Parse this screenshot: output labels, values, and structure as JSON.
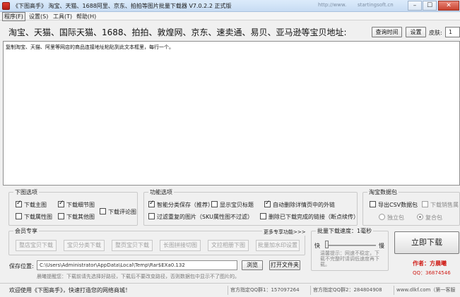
{
  "window": {
    "title": "《下图高手》 淘宝、天猫、1688阿里、京东、拍拍等图片批量下载器 V7.0.2.2 正式版",
    "ghost_tabs": [
      "http://www.",
      "startingsoft.cn"
    ],
    "minimize": "–",
    "maximize": "☐",
    "close": "✕"
  },
  "menu": [
    {
      "label": "程序(F)",
      "active": true
    },
    {
      "label": "设置(S)"
    },
    {
      "label": "工具(T)"
    },
    {
      "label": "帮助(H)"
    }
  ],
  "header": {
    "title": "淘宝、天猫、国际天猫、1688、拍拍、敦煌网、京东、速卖通、易贝、亚马逊等宝贝地址:",
    "query_time_button": "查询时间",
    "settings_button": "设置",
    "skin_label": "皮肤:",
    "skin_value": "1"
  },
  "url_textarea": {
    "text": "复制淘宝、天猫、阿里等网店的商品连接地址粘贴到此文本框里，每行一个。"
  },
  "download_options": {
    "title": "下图选项",
    "items": [
      {
        "label": "下载主图",
        "checked": true
      },
      {
        "label": "下载细节图",
        "checked": true
      },
      {
        "label": "下载评论图",
        "checked": false
      },
      {
        "label": "下载属性图",
        "checked": false
      },
      {
        "label": "下载其他图",
        "checked": false
      }
    ]
  },
  "features": {
    "title": "功能选项",
    "items": [
      {
        "label": "智能分类保存（推荐）",
        "checked": true
      },
      {
        "label": "显示宝贝标题",
        "checked": false
      },
      {
        "label": "自动删除详情页中的外链",
        "checked": true
      },
      {
        "label": "过滤重复的图片（SKU属性图不过滤）",
        "checked": false
      },
      {
        "label": "删除已下载完成的链接（断点续传）",
        "checked": false
      }
    ]
  },
  "taobao_data": {
    "title": "淘宝数据包",
    "export_csv": "导出CSV数据包",
    "download_sales": "下载销售属",
    "radio_single": "独立包",
    "radio_merged": "复合包"
  },
  "member": {
    "title": "会员专享",
    "more_link": "更多专享功能>>>",
    "buttons": [
      "整店宝贝下载",
      "宝贝分类下载",
      "整页宝贝下载",
      "长图拼接切图",
      "文拉相册下图",
      "批量加水印设置"
    ]
  },
  "speed": {
    "title": "批量下载速度：1毫秒",
    "fast": "快",
    "slow": "慢",
    "hint": "温馨提示：网速不稳定，下载不完整时请调低速度再下载。"
  },
  "save": {
    "label": "保存位置:",
    "path": "C:\\Users\\Administrator\\AppData\\Local\\Temp\\Rar$EXa0.132",
    "browse_button": "浏览",
    "open_folder_button": "打开文件夹",
    "hint": "晨曦提醒您：下载前请先选择好路径，下载后不要改变路径，否则数据包中显示不了图片的。"
  },
  "download_now": "立即下载",
  "author": {
    "author": "作者：方晨曦",
    "qq": "QQ：36874546"
  },
  "statusbar": {
    "welcome": "欢迎使用《下图高手》，快速打造您的网络商城！",
    "group1": "官方指定QQ群1：157097264",
    "group2": "官方指定QQ群2：284804908",
    "website": "www.dlkf.com（第一客服"
  },
  "colors": {
    "author_red": "#d0201a",
    "qq_red": "#d0201a",
    "title_bar": "#cfe0f5"
  }
}
